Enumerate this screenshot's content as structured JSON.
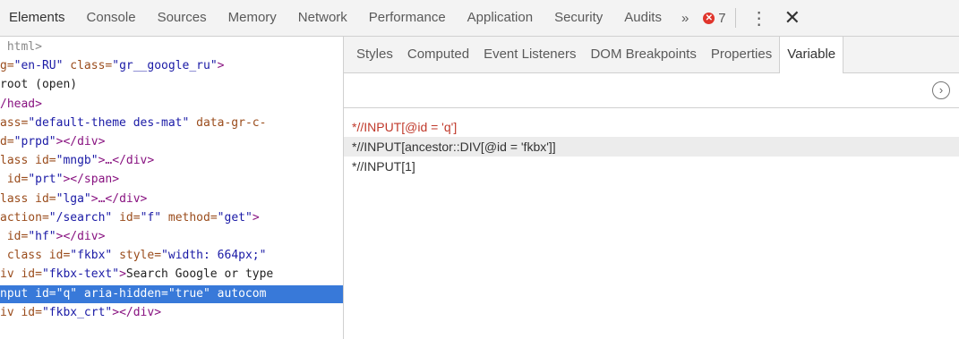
{
  "topbar": {
    "tabs": [
      "Elements",
      "Console",
      "Sources",
      "Memory",
      "Network",
      "Performance",
      "Application",
      "Security",
      "Audits"
    ],
    "more_label": "»",
    "error_count": "7",
    "error_icon": "error-circle-icon",
    "menu_label": "⋮",
    "close_label": "✕"
  },
  "code_lines": [
    {
      "parts": [
        {
          "t": " html>",
          "c": "c-gray"
        }
      ]
    },
    {
      "parts": [
        {
          "t": "g=",
          "c": "c-attr"
        },
        {
          "t": "\"en-RU\"",
          "c": "c-val"
        },
        {
          "t": " class=",
          "c": "c-attr"
        },
        {
          "t": "\"gr__google_ru\"",
          "c": "c-val"
        },
        {
          "t": ">",
          "c": "c-tag"
        }
      ]
    },
    {
      "parts": [
        {
          "t": "root (open)",
          "c": "c-txt"
        }
      ]
    },
    {
      "parts": [
        {
          "t": "/head>",
          "c": "c-tag"
        }
      ]
    },
    {
      "parts": [
        {
          "t": "ass=",
          "c": "c-attr"
        },
        {
          "t": "\"default-theme des-mat\"",
          "c": "c-val"
        },
        {
          "t": " data-gr-c-",
          "c": "c-attr"
        }
      ]
    },
    {
      "parts": [
        {
          "t": "d=",
          "c": "c-attr"
        },
        {
          "t": "\"prpd\"",
          "c": "c-val"
        },
        {
          "t": "></div>",
          "c": "c-tag"
        }
      ]
    },
    {
      "parts": [
        {
          "t": "lass id=",
          "c": "c-attr"
        },
        {
          "t": "\"mngb\"",
          "c": "c-val"
        },
        {
          "t": ">…</div>",
          "c": "c-tag"
        }
      ]
    },
    {
      "parts": [
        {
          "t": " id=",
          "c": "c-attr"
        },
        {
          "t": "\"prt\"",
          "c": "c-val"
        },
        {
          "t": "></span>",
          "c": "c-tag"
        }
      ]
    },
    {
      "parts": [
        {
          "t": "lass id=",
          "c": "c-attr"
        },
        {
          "t": "\"lga\"",
          "c": "c-val"
        },
        {
          "t": ">…</div>",
          "c": "c-tag"
        }
      ]
    },
    {
      "parts": [
        {
          "t": "action=",
          "c": "c-attr"
        },
        {
          "t": "\"/search\"",
          "c": "c-val"
        },
        {
          "t": " id=",
          "c": "c-attr"
        },
        {
          "t": "\"f\"",
          "c": "c-val"
        },
        {
          "t": " method=",
          "c": "c-attr"
        },
        {
          "t": "\"get\"",
          "c": "c-val"
        },
        {
          "t": ">",
          "c": "c-tag"
        }
      ]
    },
    {
      "parts": [
        {
          "t": " id=",
          "c": "c-attr"
        },
        {
          "t": "\"hf\"",
          "c": "c-val"
        },
        {
          "t": "></div>",
          "c": "c-tag"
        }
      ]
    },
    {
      "parts": [
        {
          "t": " class id=",
          "c": "c-attr"
        },
        {
          "t": "\"fkbx\"",
          "c": "c-val"
        },
        {
          "t": " style=",
          "c": "c-attr"
        },
        {
          "t": "\"width: 664px;\"",
          "c": "c-val"
        }
      ]
    },
    {
      "parts": [
        {
          "t": "iv id=",
          "c": "c-attr"
        },
        {
          "t": "\"fkbx-text\"",
          "c": "c-val"
        },
        {
          "t": ">",
          "c": "c-tag"
        },
        {
          "t": "Search Google or type",
          "c": "c-txt"
        }
      ]
    },
    {
      "parts": [
        {
          "t": "nput id=\"q\" aria-hidden=\"true\" autocom",
          "c": ""
        }
      ],
      "selected": true
    },
    {
      "parts": [
        {
          "t": "iv id=",
          "c": "c-attr"
        },
        {
          "t": "\"fkbx_crt\"",
          "c": "c-val"
        },
        {
          "t": "></div>",
          "c": "c-tag"
        }
      ]
    }
  ],
  "subtabs": [
    "Styles",
    "Computed",
    "Event Listeners",
    "DOM Breakpoints",
    "Properties",
    "Variable"
  ],
  "active_subtab": "Variable",
  "next_button_label": "›",
  "xpaths": [
    "*//INPUT[@id = 'q']",
    "*//INPUT[ancestor::DIV[@id = 'fkbx']]",
    "*//INPUT[1]"
  ],
  "colors": {
    "selection": "#3879d9",
    "error_red": "#e0342b",
    "xpath_red": "#c0392b"
  }
}
